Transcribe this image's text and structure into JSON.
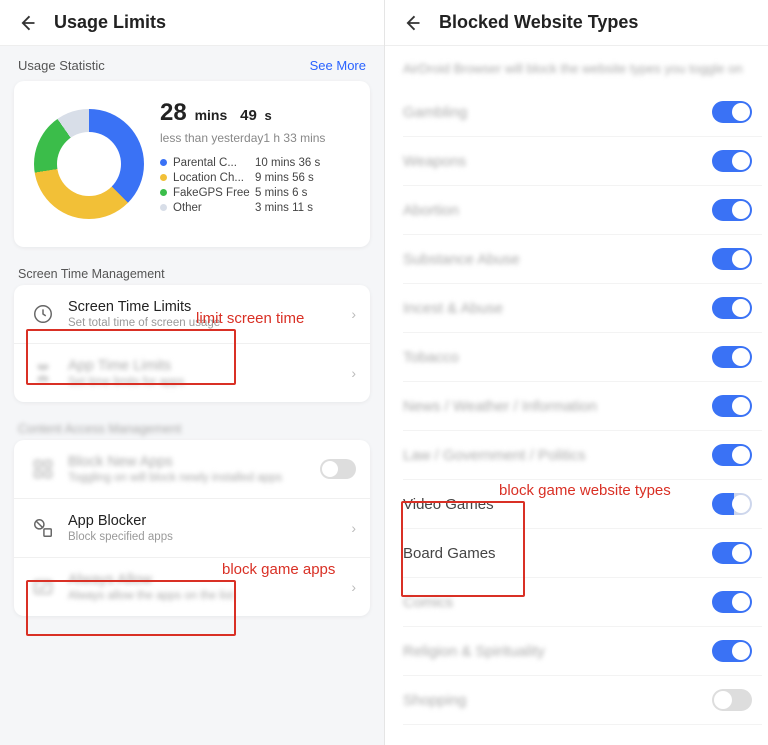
{
  "left": {
    "header": {
      "title": "Usage Limits"
    },
    "statistic_label": "Usage Statistic",
    "see_more": "See More",
    "usage": {
      "value": "28",
      "value_unit1": "mins",
      "value_sec": "49",
      "value_unit2": "s",
      "compare": "less than yesterday1 h 33 mins"
    },
    "apps": [
      {
        "color": "#3a72f5",
        "name": "Parental C...",
        "time": "10 mins 36 s"
      },
      {
        "color": "#f2c037",
        "name": "Location Ch...",
        "time": "9 mins 56 s"
      },
      {
        "color": "#3bbd4a",
        "name": "FakeGPS Free",
        "time": "5 mins 6 s"
      },
      {
        "color": "#d8dee8",
        "name": "Other",
        "time": "3 mins 11 s"
      }
    ],
    "sections": {
      "screen_mgmt": "Screen Time Management",
      "content_mgmt": "Content Access Management"
    },
    "items": {
      "screen_limits": {
        "title": "Screen Time Limits",
        "sub": "Set total time of screen usage"
      },
      "app_limits": {
        "title": "App Time Limits",
        "sub": "Set time limits for apps"
      },
      "block_new": {
        "title": "Block New Apps",
        "sub": "Toggling on will block newly installed apps"
      },
      "app_blocker": {
        "title": "App Blocker",
        "sub": "Block specified apps"
      },
      "always_allow": {
        "title": "Always Allow",
        "sub": "Always allow the apps on the list"
      }
    },
    "annot": {
      "limit": "limit screen time",
      "block_apps": "block game apps"
    }
  },
  "right": {
    "header": {
      "title": "Blocked Website Types"
    },
    "desc": "AirDroid Browser will block the website types you toggle on",
    "items": [
      {
        "label": "Gambling",
        "on": true,
        "blur": true
      },
      {
        "label": "Weapons",
        "on": true,
        "blur": true
      },
      {
        "label": "Abortion",
        "on": true,
        "blur": true
      },
      {
        "label": "Substance Abuse",
        "on": true,
        "blur": true
      },
      {
        "label": "Incest & Abuse",
        "on": true,
        "blur": true
      },
      {
        "label": "Tobacco",
        "on": true,
        "blur": true
      },
      {
        "label": "News / Weather / Information",
        "on": true,
        "blur": true
      },
      {
        "label": "Law / Government / Politics",
        "on": true,
        "blur": true
      },
      {
        "label": "Video Games",
        "on": true,
        "blur": false,
        "partial": true
      },
      {
        "label": "Board Games",
        "on": true,
        "blur": false
      },
      {
        "label": "Comics",
        "on": true,
        "blur": true
      },
      {
        "label": "Religion & Spirituality",
        "on": true,
        "blur": true
      },
      {
        "label": "Shopping",
        "on": false,
        "blur": true
      }
    ],
    "annot": {
      "block_web": "block game website types"
    }
  },
  "chart_data": {
    "type": "pie",
    "title": "Usage Statistic",
    "categories": [
      "Parental C...",
      "Location Ch...",
      "FakeGPS Free",
      "Other"
    ],
    "values_seconds": [
      636,
      596,
      306,
      191
    ],
    "total_seconds": 1729
  }
}
